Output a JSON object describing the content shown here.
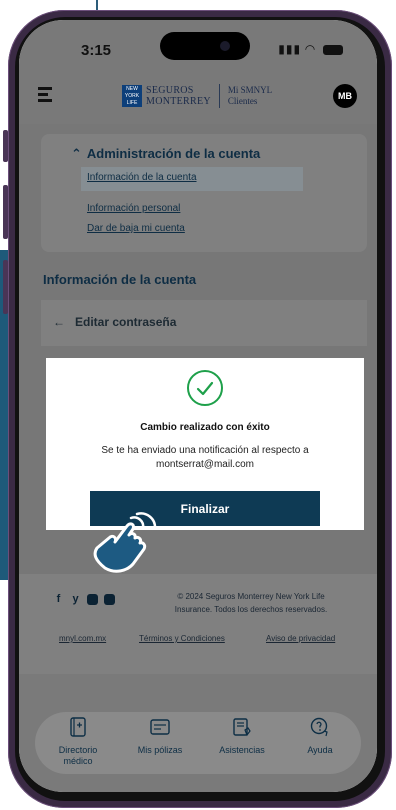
{
  "status_bar": {
    "time": "3:15"
  },
  "header": {
    "logo_box": "NEW YORK LIFE",
    "brand_line1": "SEGUROS",
    "brand_line2": "MONTERREY",
    "sub_line1": "Mi SMNYL",
    "sub_line2": "Clientes",
    "avatar_initials": "MB"
  },
  "account_menu": {
    "heading": "Administración de la cuenta",
    "items": [
      {
        "label": "Información de la cuenta",
        "active": true
      },
      {
        "label": "Información personal",
        "active": false
      },
      {
        "label": "Dar de baja mi cuenta",
        "active": false
      }
    ]
  },
  "section": {
    "title": "Información de la cuenta",
    "edit_label": "Editar contraseña"
  },
  "modal": {
    "title": "Cambio realizado con éxito",
    "body_line1": "Se te ha enviado una notificación al respecto a",
    "body_line2": "montserrat@mail.com",
    "button_label": "Finalizar",
    "success_color": "#1ea04a",
    "button_color": "#0e3a54"
  },
  "footer": {
    "social_icons": [
      "facebook-icon",
      "twitter-icon",
      "instagram-icon",
      "linkedin-icon"
    ],
    "copyright_line1": "© 2024 Seguros Monterrey New York Life",
    "copyright_line2": "Insurance. Todos los derechos reservados.",
    "links": [
      "mnyl.com.mx",
      "Términos y Condiciones",
      "Aviso de privacidad"
    ]
  },
  "bottom_nav": {
    "items": [
      {
        "label_line1": "Directorio",
        "label_line2": "médico",
        "icon": "book-icon"
      },
      {
        "label_line1": "Mis pólizas",
        "label_line2": "",
        "icon": "policy-card-icon"
      },
      {
        "label_line1": "Asistencias",
        "label_line2": "",
        "icon": "assistance-icon"
      },
      {
        "label_line1": "Ayuda",
        "label_line2": "",
        "icon": "help-icon"
      }
    ]
  }
}
